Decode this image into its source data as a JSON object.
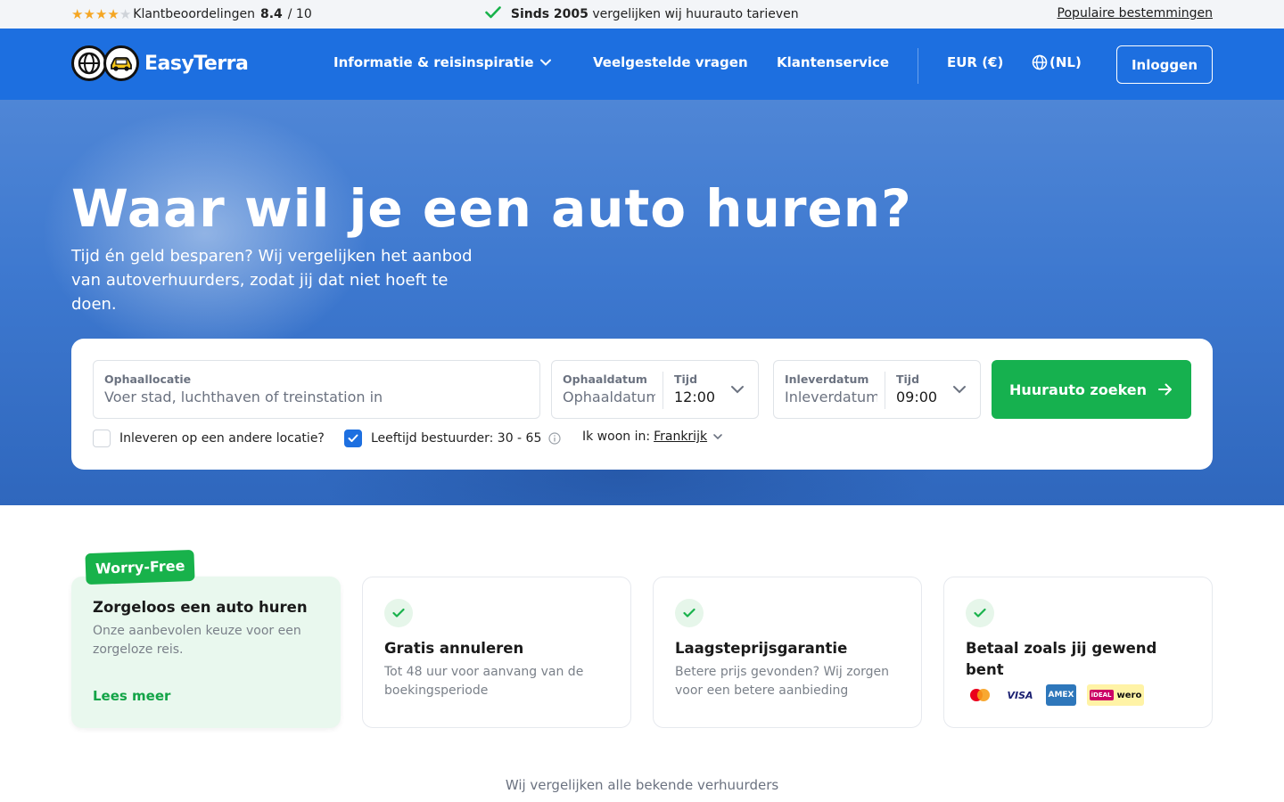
{
  "topbar": {
    "rating_label": "Klantbeoordelingen",
    "rating_score": "8.4",
    "rating_max": "/ 10",
    "stars_filled": 4,
    "stars_total": 5,
    "since_bold": "Sinds 2005",
    "since_rest": "vergelijken wij huurauto tarieven",
    "destinations_link": "Populaire bestemmingen"
  },
  "header": {
    "brand": "EasyTerra",
    "nav": {
      "info": "Informatie & reisinspiratie",
      "faq": "Veelgestelde vragen",
      "service": "Klantenservice",
      "currency": "EUR (€)",
      "language": "(NL)"
    },
    "login": "Inloggen"
  },
  "hero": {
    "title": "Waar wil je een auto huren?",
    "subtitle": "Tijd én geld besparen? Wij vergelijken het aanbod van autoverhuurders, zodat jij dat niet hoeft te doen."
  },
  "search": {
    "pickup_location_label": "Ophaallocatie",
    "pickup_location_placeholder": "Voer stad, luchthaven of treinstation in",
    "pickup_date_label": "Ophaaldatum",
    "pickup_date_placeholder": "Ophaaldatum",
    "pickup_time_label": "Tijd",
    "pickup_time_value": "12:00",
    "return_date_label": "Inleverdatum",
    "return_date_placeholder": "Inleverdatum",
    "return_time_label": "Tijd",
    "return_time_value": "09:00",
    "submit": "Huurauto zoeken",
    "other_location": "Inleveren op een andere locatie?",
    "driver_age": "Leeftijd bestuurder: 30 - 65",
    "live_in_label": "Ik woon in:",
    "live_in_value": "Frankrijk"
  },
  "features": {
    "badge": "Worry-Free",
    "card1": {
      "title": "Zorgeloos een auto huren",
      "text": "Onze aanbevolen keuze voor een zorgeloze reis.",
      "link": "Lees meer"
    },
    "card2": {
      "title": "Gratis annuleren",
      "text": "Tot 48 uur voor aanvang van de boekingsperiode"
    },
    "card3": {
      "title": "Laagsteprijsgarantie",
      "text": "Betere prijs gevonden? Wij zorgen voor een betere aanbieding"
    },
    "card4": {
      "title": "Betaal zoals jij gewend bent",
      "payments": {
        "visa": "VISA",
        "amex": "AMEX",
        "ideal": "iDEAL",
        "wero": "wero"
      }
    }
  },
  "compare_text": "Wij vergelijken alle bekende verhuurders",
  "colors": {
    "brand_blue": "#1d6fe0",
    "cta_green": "#16b14f",
    "star": "#f5a623"
  }
}
